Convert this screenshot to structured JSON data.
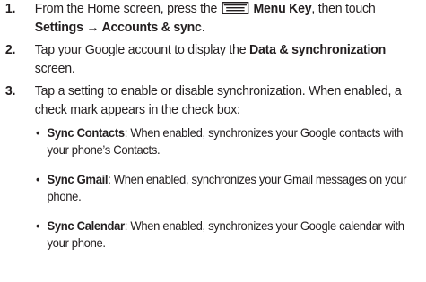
{
  "steps": [
    {
      "number": "1.",
      "part1": "From the Home screen, press the ",
      "menu_key": "Menu Key",
      "part2": ", then touch ",
      "path": "Settings → Accounts & sync",
      "part3": "."
    },
    {
      "number": "2.",
      "part1": "Tap your Google account to display the ",
      "screen_name": "Data & synchronization",
      "part2": " screen."
    },
    {
      "number": "3.",
      "text": "Tap a setting to enable or disable synchronization. When enabled, a check mark appears in the check box:"
    }
  ],
  "bullets": [
    {
      "symbol": "•",
      "term": "Sync Contacts",
      "description": ": When enabled, synchronizes your Google contacts with your phone’s Contacts."
    },
    {
      "symbol": "•",
      "term": "Sync Gmail",
      "description": ": When enabled, synchronizes your Gmail messages on your phone."
    },
    {
      "symbol": "•",
      "term": "Sync Calendar",
      "description": ": When enabled, synchronizes your Google calendar with your phone."
    }
  ],
  "icons": {
    "menu_key_icon": "menu-key-icon"
  },
  "colors": {
    "text": "#231f20",
    "icon": "#231f20"
  }
}
